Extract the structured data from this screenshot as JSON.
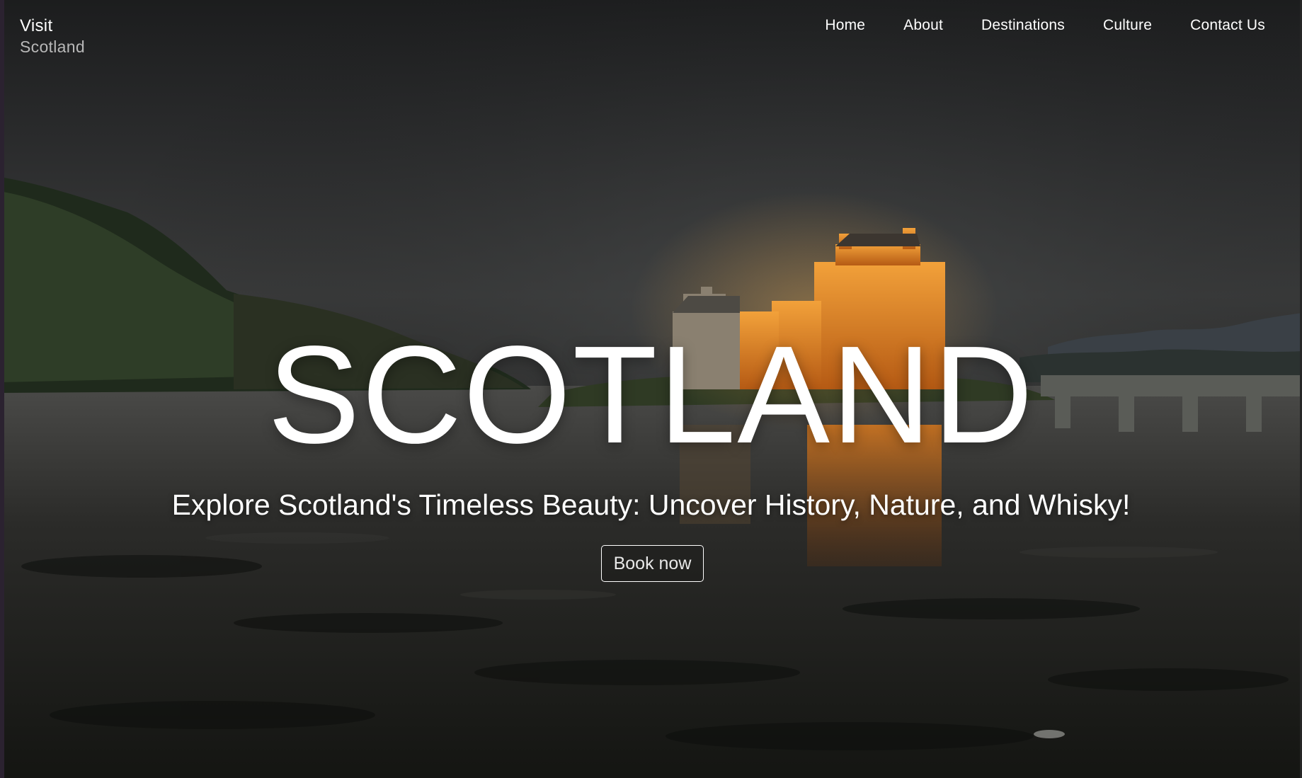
{
  "brand": {
    "line1": "Visit",
    "line2": "Scotland"
  },
  "nav": {
    "items": [
      "Home",
      "About",
      "Destinations",
      "Culture",
      "Contact Us"
    ]
  },
  "hero": {
    "title": "SCOTLAND",
    "subtitle": "Explore Scotland's Timeless Beauty: Uncover History, Nature, and Whisky!",
    "button_label": "Book now"
  },
  "colors": {
    "text": "#ffffff",
    "brand_secondary": "#b8b8b8",
    "castle_glow": "#e0801f",
    "sky_dark": "#1c1d1e"
  }
}
